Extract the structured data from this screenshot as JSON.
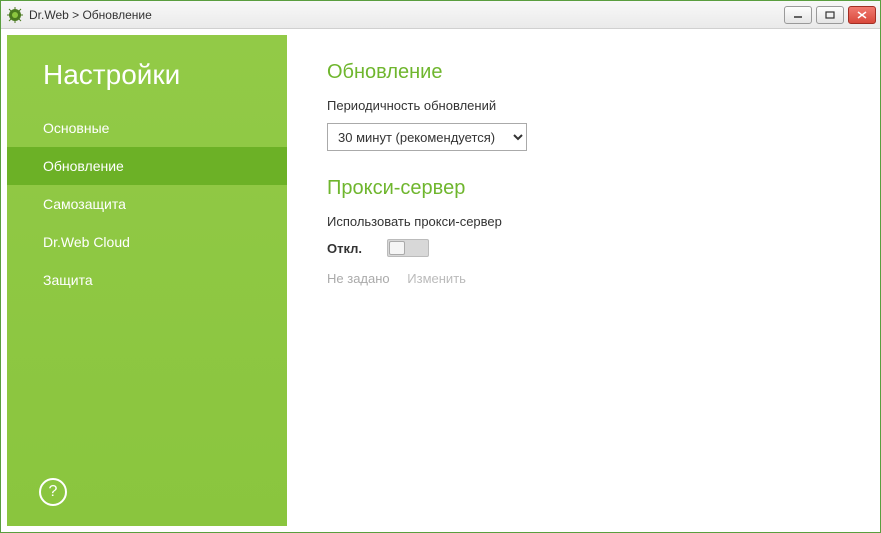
{
  "window": {
    "title": "Dr.Web > Обновление"
  },
  "sidebar": {
    "title": "Настройки",
    "items": [
      {
        "label": "Основные",
        "active": false
      },
      {
        "label": "Обновление",
        "active": true
      },
      {
        "label": "Самозащита",
        "active": false
      },
      {
        "label": "Dr.Web Cloud",
        "active": false
      },
      {
        "label": "Защита",
        "active": false
      }
    ],
    "help": "?"
  },
  "content": {
    "update": {
      "title": "Обновление",
      "frequency_label": "Периодичность обновлений",
      "frequency_value": "30 минут (рекомендуется)"
    },
    "proxy": {
      "title": "Прокси-сервер",
      "use_label": "Использовать прокси-сервер",
      "state_label": "Откл.",
      "status_text": "Не задано",
      "change_text": "Изменить"
    }
  }
}
